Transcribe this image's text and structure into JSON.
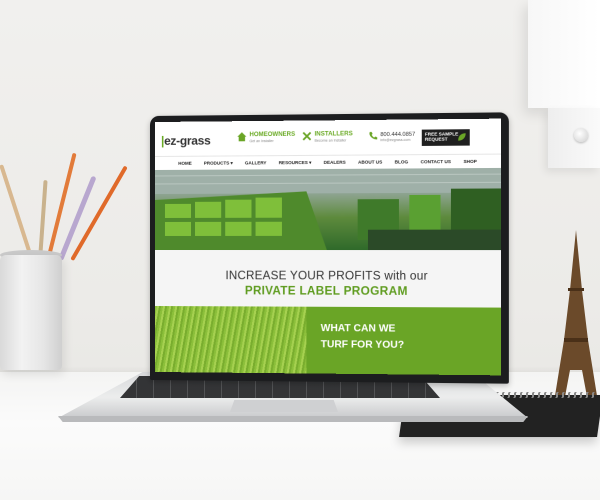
{
  "site": {
    "logo": "ez-grass",
    "header": {
      "homeowners": "HOMEOWNERS",
      "homeowners_sub": "Get an Installer",
      "installers": "INSTALLERS",
      "installers_sub": "Become an Installer",
      "phone": "800.444.0857",
      "email": "info@ezgrass.com",
      "sample_line1": "FREE SAMPLE",
      "sample_line2": "REQUEST"
    },
    "nav": [
      "HOME",
      "PRODUCTS ▾",
      "GALLERY",
      "RESOURCES ▾",
      "DEALERS",
      "ABOUT US",
      "BLOG",
      "CONTACT US",
      "SHOP"
    ],
    "promo": {
      "line1": "INCREASE YOUR PROFITS with our",
      "line2": "PRIVATE LABEL PROGRAM"
    },
    "cta": {
      "line1": "WHAT CAN WE",
      "line2": "TURF FOR YOU?"
    }
  },
  "colors": {
    "brand_green": "#6aa526",
    "dark": "#1f1f1f"
  },
  "icons": [
    "home-icon",
    "tools-icon",
    "phone-icon",
    "leaf-icon"
  ]
}
